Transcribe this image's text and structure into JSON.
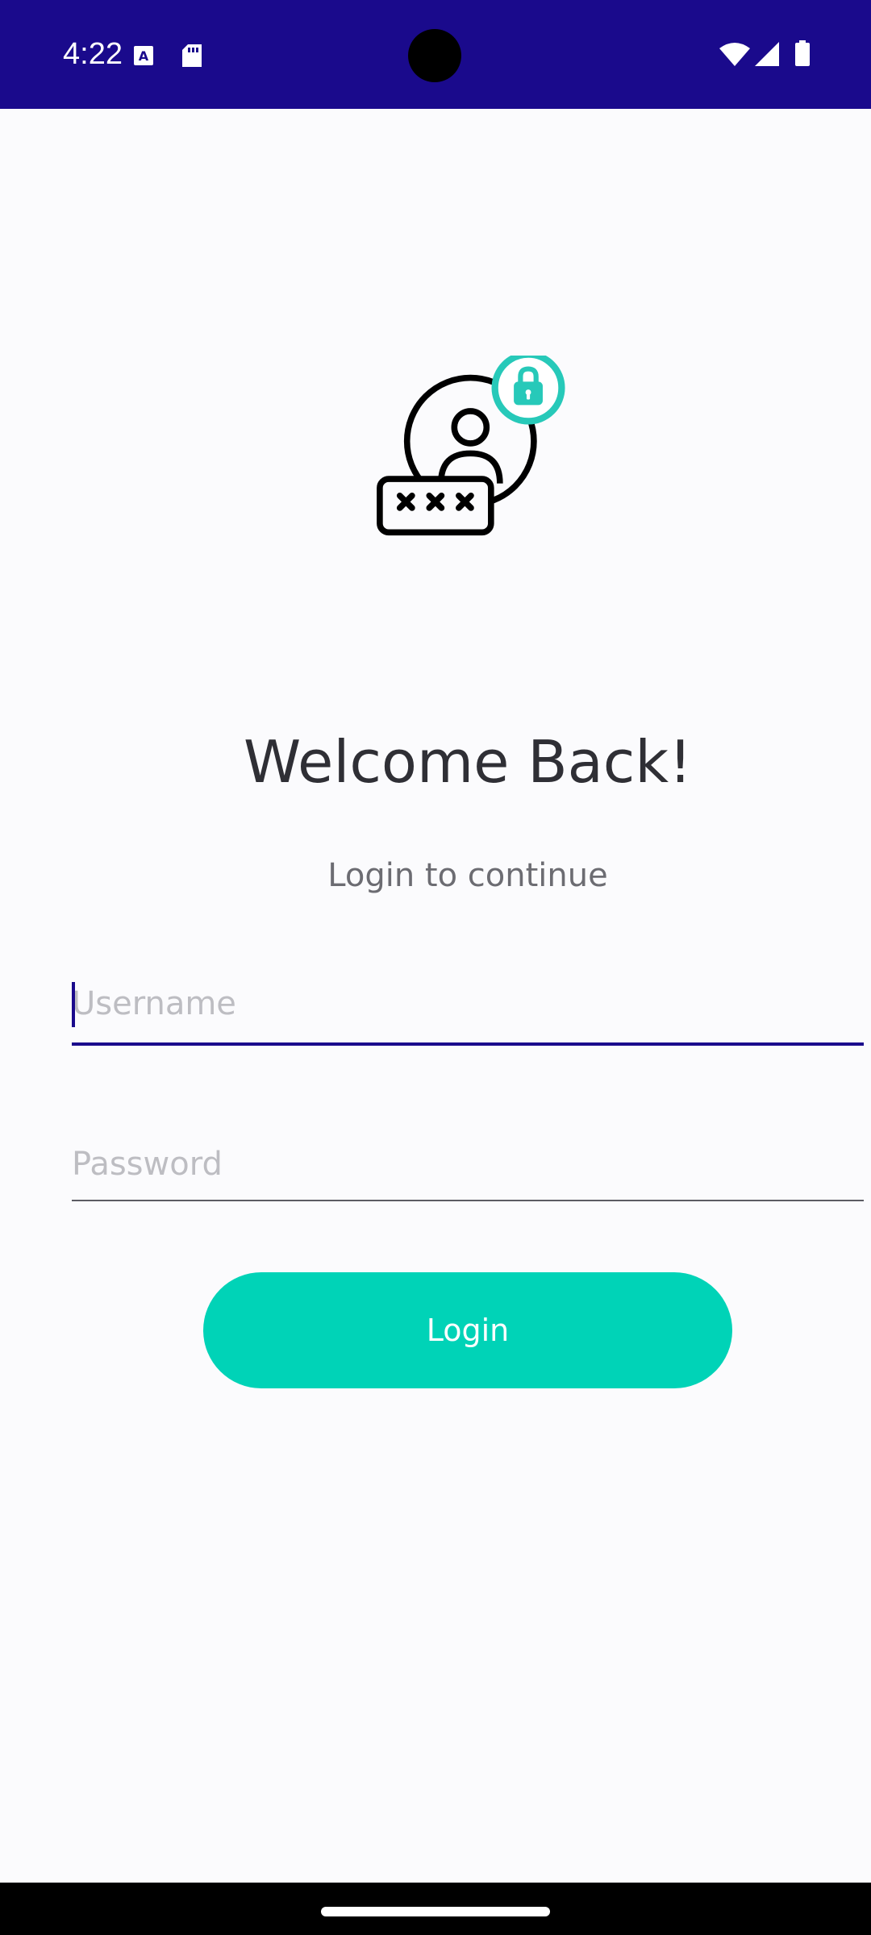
{
  "status_bar": {
    "time": "4:22",
    "left_icons": [
      "font-icon",
      "sd-card-icon"
    ],
    "right_icons": [
      "wifi-icon",
      "cellular-signal-icon",
      "battery-icon"
    ],
    "background_color": "#1a0a8c"
  },
  "hero": {
    "illustration": "user-password-lock-icon",
    "accent_color": "#27c9b9"
  },
  "screen": {
    "title": "Welcome Back!",
    "subtitle": "Login to continue"
  },
  "form": {
    "username": {
      "placeholder": "Username",
      "value": ""
    },
    "password": {
      "placeholder": "Password",
      "value": ""
    },
    "submit_label": "Login",
    "accent_color": "#00d3b7"
  }
}
